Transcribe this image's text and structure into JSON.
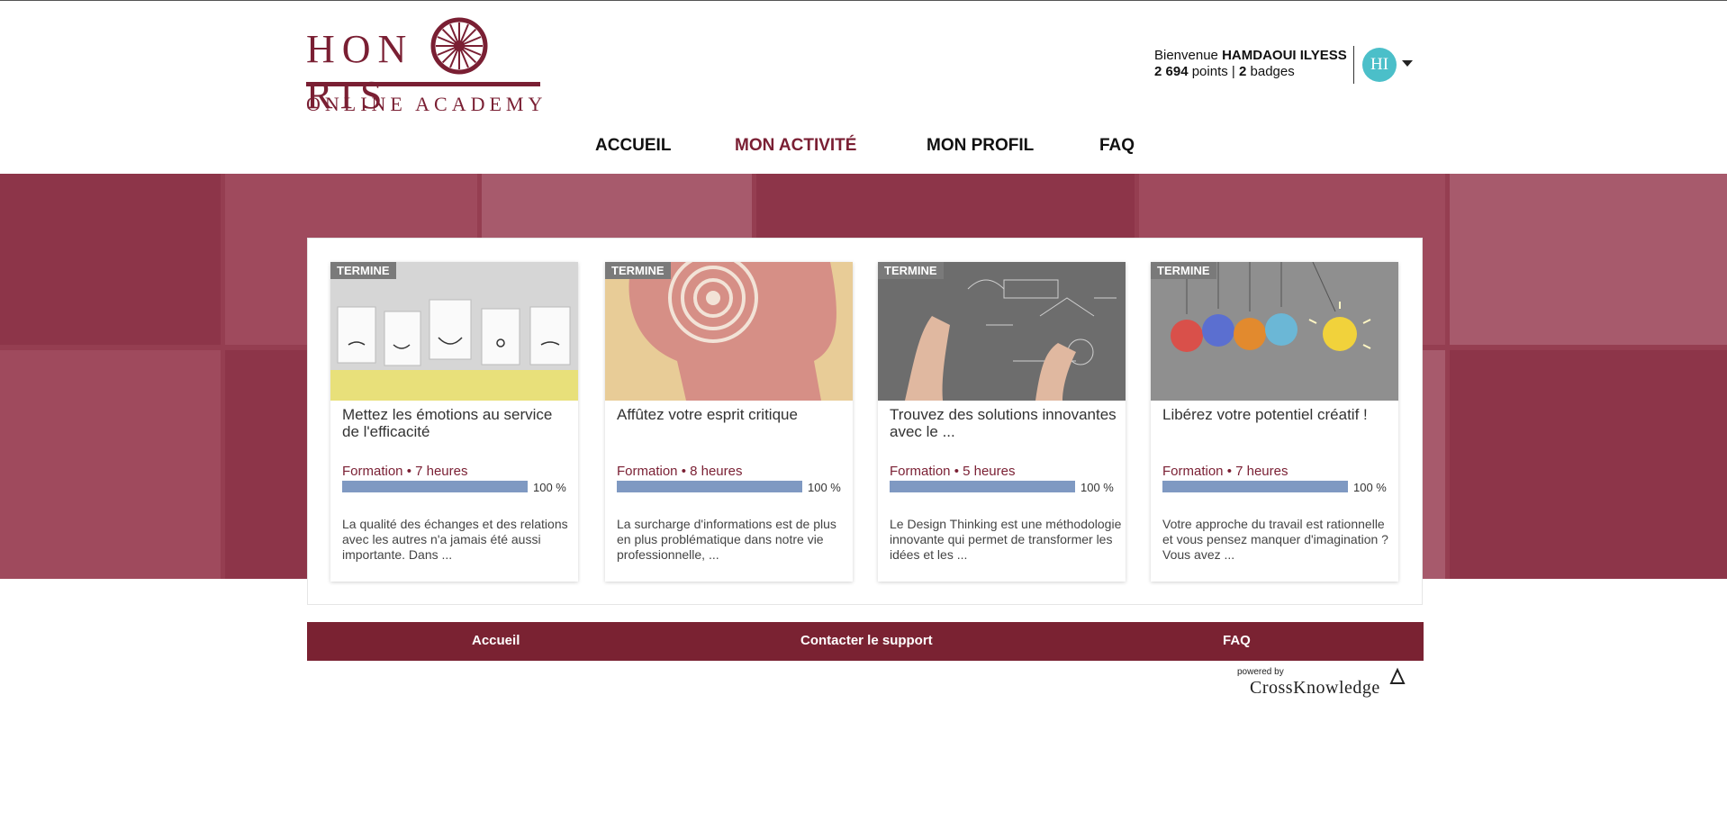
{
  "brand": {
    "logo_word_left": "HON",
    "logo_word_right": "RIS",
    "logo_sub": "ONLINE ACADEMY",
    "accent": "#7a1f33"
  },
  "user": {
    "greeting": "Bienvenue",
    "name": "HAMDAOUI ILYESS",
    "points_value": "2 694",
    "points_label": "points",
    "separator": "|",
    "badges_value": "2",
    "badges_label": "badges",
    "initials": "HI",
    "avatar_color": "#4bbfc9"
  },
  "nav": {
    "items": [
      {
        "label": "ACCUEIL",
        "active": false
      },
      {
        "label": "MON ACTIVITÉ",
        "active": true
      },
      {
        "label": "MON PROFIL",
        "active": false
      },
      {
        "label": "FAQ",
        "active": false
      }
    ]
  },
  "cards": [
    {
      "badge": "TERMINE",
      "title": "Mettez les émotions au service de l'efficacité",
      "meta": "Formation • 7 heures",
      "progress": 100,
      "progress_label": "100 %",
      "description": "La qualité des échanges et des relations avec les autres n'a jamais été aussi importante. Dans ..."
    },
    {
      "badge": "TERMINE",
      "title": "Affûtez votre esprit critique",
      "meta": "Formation • 8 heures",
      "progress": 100,
      "progress_label": "100 %",
      "description": "La surcharge d'informations est de plus en plus problématique dans notre vie professionnelle, ..."
    },
    {
      "badge": "TERMINE",
      "title": "Trouvez des solutions innovantes avec le ...",
      "meta": "Formation • 5 heures",
      "progress": 100,
      "progress_label": "100 %",
      "description": "Le Design Thinking est une méthodologie innovante qui permet de transformer les idées et les ..."
    },
    {
      "badge": "TERMINE",
      "title": "Libérez votre potentiel créatif !",
      "meta": "Formation • 7 heures",
      "progress": 100,
      "progress_label": "100 %",
      "description": "Votre approche du travail est rationnelle et vous pensez manquer d'imagination ? Vous avez ..."
    }
  ],
  "footer": {
    "links": [
      "Accueil",
      "Contacter le support",
      "FAQ"
    ],
    "powered_by": "powered by",
    "vendor": "CrossKnowledge",
    "bg": "#7a2232"
  }
}
